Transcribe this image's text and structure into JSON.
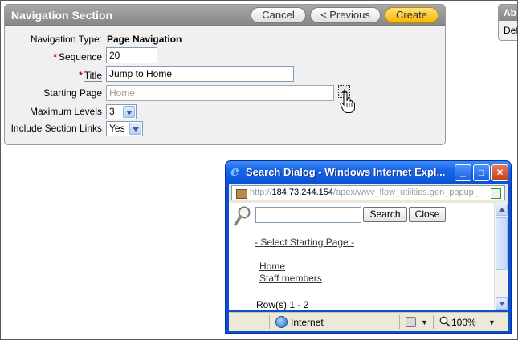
{
  "nav_section": {
    "title": "Navigation Section",
    "buttons": {
      "cancel": "Cancel",
      "previous": "< Previous",
      "create": "Create"
    },
    "fields": {
      "navigation_type": {
        "label": "Navigation Type:",
        "value": "Page Navigation"
      },
      "sequence": {
        "label": "Sequence",
        "value": "20",
        "required": true
      },
      "title": {
        "label": "Title",
        "value": "Jump to Home",
        "required": true
      },
      "starting_page": {
        "label": "Starting Page",
        "placeholder": "Home"
      },
      "maximum_levels": {
        "label": "Maximum Levels",
        "value": "3"
      },
      "include_section_links": {
        "label": "Include Section Links",
        "value": "Yes"
      }
    }
  },
  "side_panel": {
    "title": "Ab",
    "text": "Def"
  },
  "search_dialog": {
    "window_title": "Search Dialog - Windows Internet Expl...",
    "address": {
      "scheme": "http://",
      "host": "184.73.244.154",
      "path": "/apex/wwv_flow_utilities.gen_popup_"
    },
    "search_button": "Search",
    "close_button": "Close",
    "select_link": "- Select Starting Page -",
    "results": [
      "Home",
      "Staff members"
    ],
    "rows_text": "Row(s) 1 - 2",
    "status": {
      "zone": "Internet",
      "zoom": "100%"
    }
  },
  "colors": {
    "header": "#8f8f8f",
    "create_button": "#f7b500",
    "required": "#c00000",
    "titlebar": "#0a52d6"
  }
}
